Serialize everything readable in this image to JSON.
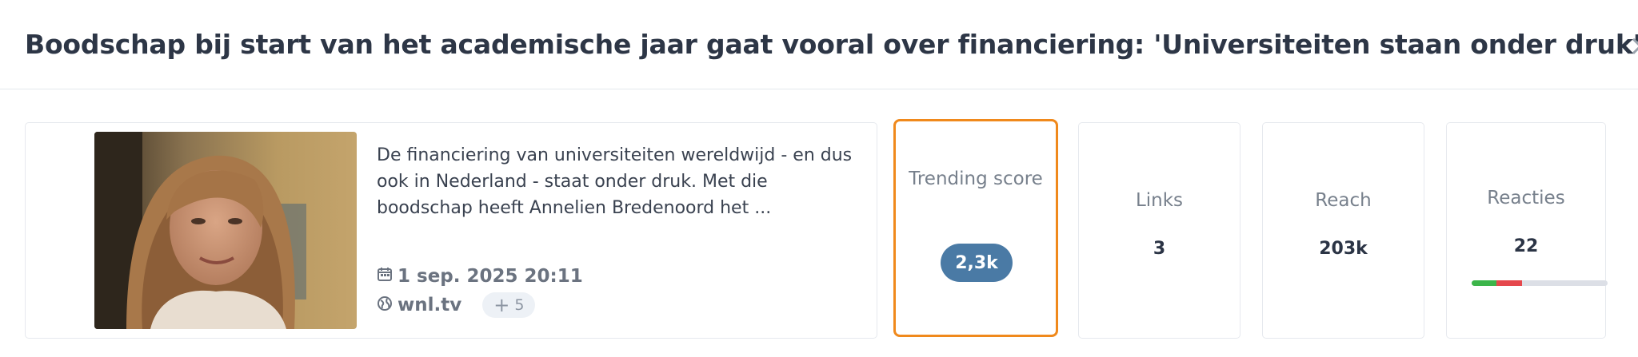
{
  "header": {
    "title": "Boodschap bij start van het academische jaar gaat vooral over financiering: 'Universiteiten staan onder druk'",
    "close_label": "×"
  },
  "article": {
    "description": "De financiering van universiteiten wereldwijd - en dus ook in Nederland - staat onder druk. Met die boodschap heeft Annelien Bredenoord het ...",
    "date": "1 sep. 2025 20:11",
    "source": "wnl.tv",
    "extra_sources": "5"
  },
  "metrics": {
    "trending": {
      "label": "Trending score",
      "value": "2,3k"
    },
    "links": {
      "label": "Links",
      "value": "3"
    },
    "reach": {
      "label": "Reach",
      "value": "203k"
    },
    "reacties": {
      "label": "Reacties",
      "value": "22",
      "sentiment": {
        "positive_fraction": 0.18,
        "negative_fraction": 0.19
      }
    }
  },
  "colors": {
    "accent_orange": "#f0891c",
    "trend_pill": "#4a7aa5",
    "sentiment_positive": "#3cb54a",
    "sentiment_negative": "#e5474c"
  },
  "icons": {
    "date": "calendar-icon",
    "source": "globe-icon",
    "close": "close-icon"
  }
}
